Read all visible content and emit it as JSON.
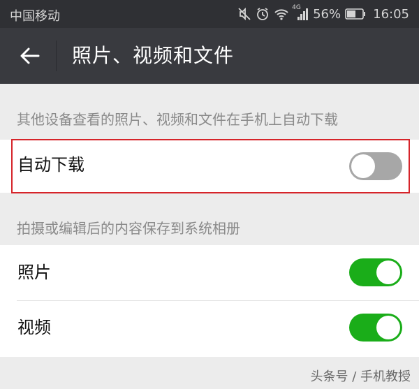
{
  "status_bar": {
    "carrier": "中国移动",
    "network": "4G",
    "battery": "56%",
    "time": "16:05",
    "icons": [
      "mute-icon",
      "alarm-icon",
      "wifi-icon",
      "signal-icon",
      "battery-icon"
    ]
  },
  "toolbar": {
    "title": "照片、视频和文件",
    "back_icon": "back-arrow-icon"
  },
  "sections": [
    {
      "header": "其他设备查看的照片、视频和文件在手机上自动下载",
      "items": [
        {
          "label": "自动下载",
          "enabled": false
        }
      ]
    },
    {
      "header": "拍摄或编辑后的内容保存到系统相册",
      "items": [
        {
          "label": "照片",
          "enabled": true
        },
        {
          "label": "视频",
          "enabled": true
        }
      ]
    }
  ],
  "watermark": "头条号 / 手机教授",
  "colors": {
    "toolbar": "#393a3f",
    "status_bar": "#2f3034",
    "switch_on": "#1aad19",
    "switch_off": "#a7a7a7",
    "highlight": "#d6242a",
    "background": "#ececec"
  }
}
